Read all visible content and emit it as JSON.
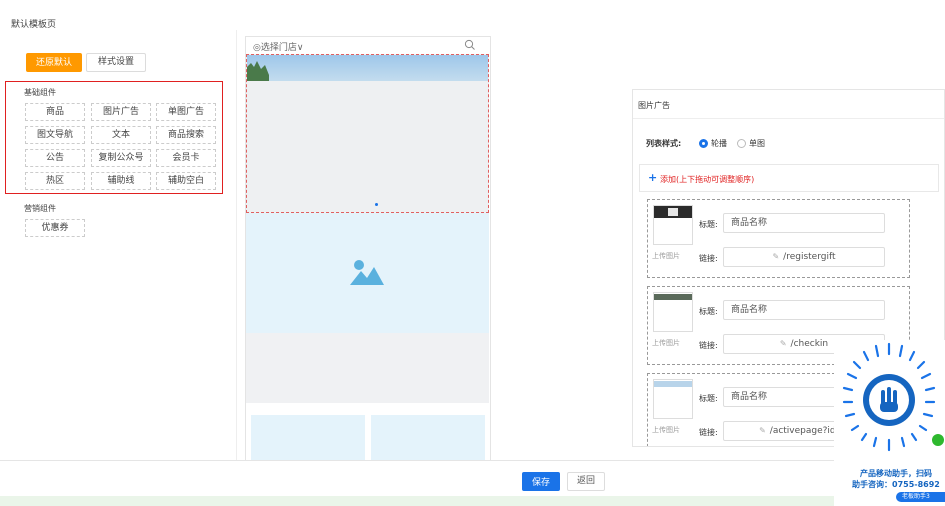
{
  "page": {
    "title": "默认模板页"
  },
  "toolbar": {
    "reset_label": "还原默认",
    "style_label": "样式设置"
  },
  "basic_components": {
    "label": "基础组件",
    "items": [
      "商品",
      "图片广告",
      "单图广告",
      "图文导航",
      "文本",
      "商品搜索",
      "公告",
      "复制公众号",
      "会员卡",
      "热区",
      "辅助线",
      "辅助空白"
    ]
  },
  "marketing_components": {
    "label": "营销组件",
    "items": [
      "优惠券"
    ]
  },
  "preview": {
    "search_placeholder": "◎选择门店∨",
    "colors": {
      "selected_border": "#e06060",
      "placeholder_bg": "#e4f3fb",
      "dot": "#1a73e8"
    }
  },
  "panel": {
    "title": "图片广告",
    "style_label": "列表样式:",
    "style_options": [
      "轮播",
      "单图"
    ],
    "selected_style": "轮播",
    "add_text": "添加(上下拖动可调整顺序)",
    "title_label": "标题:",
    "link_label": "链接:",
    "upload_label": "上传图片",
    "items": [
      {
        "title_placeholder": "商品名称",
        "link": "/registergift"
      },
      {
        "title_placeholder": "商品名称",
        "link": "/checkin"
      },
      {
        "title_placeholder": "商品名称",
        "link": "/activepage?id=1"
      }
    ]
  },
  "footer": {
    "save_label": "保存",
    "back_label": "返回"
  },
  "qr_overlay": {
    "caption_line1": "产品移动助手，扫码",
    "caption_line2": "助手咨询：0755-8692",
    "pill_text": "老板助手3"
  },
  "colors": {
    "accent_orange": "#ff9900",
    "primary_blue": "#1a73e8",
    "highlight_red": "#e02020"
  }
}
